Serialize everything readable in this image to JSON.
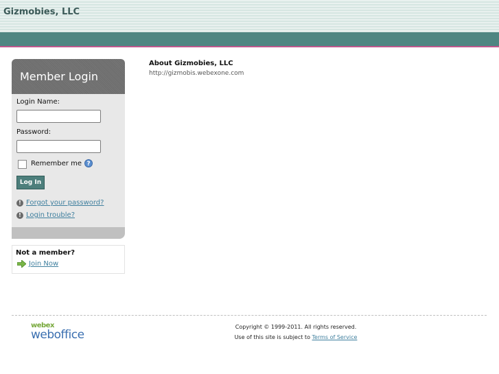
{
  "header": {
    "title": "Gizmobies, LLC"
  },
  "login": {
    "heading": "Member Login",
    "login_name_label": "Login Name:",
    "login_name_value": "",
    "password_label": "Password:",
    "password_value": "",
    "remember_label": "Remember me",
    "login_button": "Log In",
    "forgot_password": "Forgot your password?",
    "login_trouble": "Login trouble?"
  },
  "member": {
    "title": "Not a member?",
    "join": "Join Now"
  },
  "about": {
    "title": "About Gizmobies, LLC",
    "url": "http://gizmobis.webexone.com"
  },
  "footer": {
    "logo_top": "webex",
    "logo_bottom": "weboffice",
    "copyright": "Copyright © 1999-2011. All rights reserved.",
    "terms_prefix": "Use of this site is subject to ",
    "terms_link": "Terms of Service"
  },
  "colors": {
    "teal": "#4f8682",
    "accent_pink": "#c0588e",
    "link": "#3f7f9e"
  }
}
